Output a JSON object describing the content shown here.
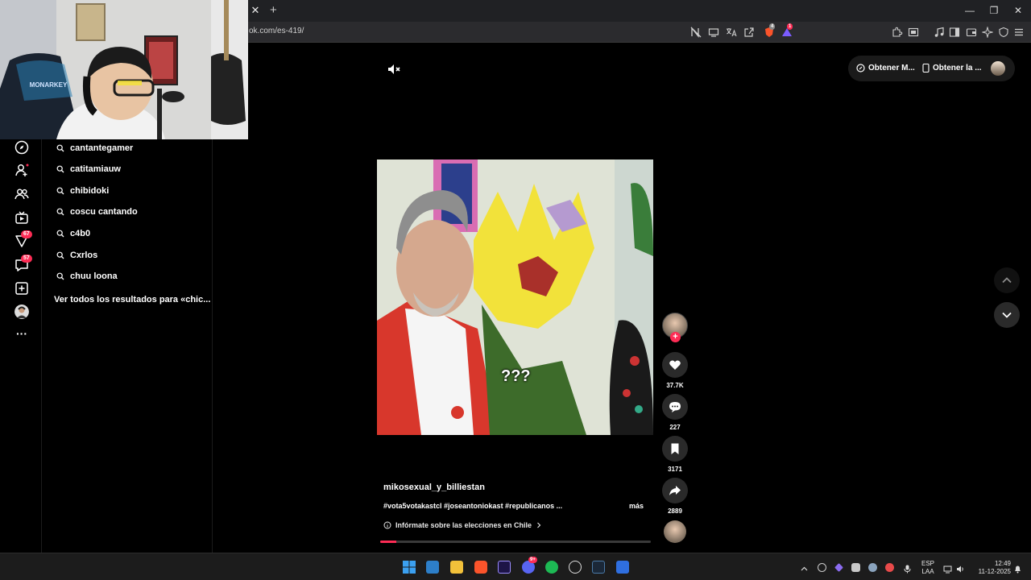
{
  "browser": {
    "url": "ok.com/es-419/",
    "tab_close": "✕",
    "tab_new": "+",
    "win_min": "—",
    "win_max": "❐",
    "win_close": "✕",
    "ext_badge_1": "4",
    "ext_badge_2": "1"
  },
  "rail": {
    "badges": {
      "inbox_like": "67",
      "messages": "57"
    },
    "more": "···"
  },
  "search_suggestions": {
    "items": [
      "cantantegamer",
      "catitamiauw",
      "chibidoki",
      "coscu cantando",
      "c4b0",
      "Cxrlos",
      "chuu loona"
    ],
    "view_all": "Ver todos los resultados para «chic..."
  },
  "top_actions": {
    "get_coins": "Obtener M...",
    "get_app": "Obtener la ..."
  },
  "video": {
    "overlay_text": "???",
    "progress": 0.06,
    "author": "mikosexual_y_billiestan",
    "description": "#vota5votakastcl #joseantoniokast #republicanos ...",
    "more": "más",
    "election_link": "Infórmate sobre las elecciones en Chile"
  },
  "actions": {
    "likes": "37.7K",
    "comments": "227",
    "saves": "3171",
    "shares": "2889"
  },
  "taskbar": {
    "lang_top": "ESP",
    "lang_bottom": "LAA",
    "time": "12:49",
    "date": "11-12-2025",
    "discord_badge": "9+"
  },
  "colors": {
    "accent": "#fe2c55",
    "background": "#000000"
  }
}
